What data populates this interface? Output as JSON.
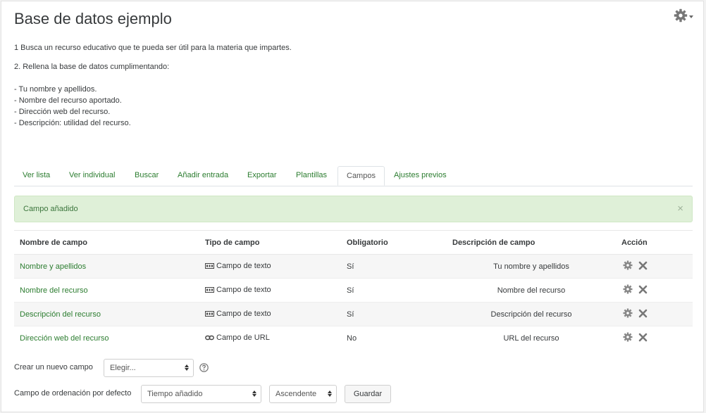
{
  "page": {
    "title": "Base de datos ejemplo"
  },
  "intro": {
    "lines": [
      "1  Busca un recurso educativo que te pueda ser útil para la materia que impartes.",
      "2. Rellena la base de datos cumplimentando:",
      "- Tu nombre y apellidos.",
      "- Nombre del recurso aportado.",
      "- Dirección web del recurso.",
      "- Descripción: utilidad del recurso."
    ]
  },
  "tabs": [
    {
      "label": "Ver lista"
    },
    {
      "label": "Ver individual"
    },
    {
      "label": "Buscar"
    },
    {
      "label": "Añadir entrada"
    },
    {
      "label": "Exportar"
    },
    {
      "label": "Plantillas"
    },
    {
      "label": "Campos",
      "active": true
    },
    {
      "label": "Ajustes previos"
    }
  ],
  "alert": {
    "message": "Campo añadido",
    "close": "×"
  },
  "table": {
    "headers": {
      "name": "Nombre de campo",
      "type": "Tipo de campo",
      "required": "Obligatorio",
      "description": "Descripción de campo",
      "action": "Acción"
    },
    "rows": [
      {
        "name": "Nombre y apellidos",
        "type": "Campo de texto",
        "type_icon": "text-field-icon",
        "required": "Sí",
        "description": "Tu nombre y apellidos"
      },
      {
        "name": "Nombre del recurso",
        "type": "Campo de texto",
        "type_icon": "text-field-icon",
        "required": "Sí",
        "description": "Nombre del recurso"
      },
      {
        "name": "Descripción del recurso",
        "type": "Campo de texto",
        "type_icon": "text-field-icon",
        "required": "Sí",
        "description": "Descripción del recurso"
      },
      {
        "name": "Dirección web del recurso",
        "type": "Campo de URL",
        "type_icon": "url-link-icon",
        "required": "No",
        "description": "URL del recurso"
      }
    ]
  },
  "new_field": {
    "label": "Crear un nuevo campo",
    "select_value": "Elegir..."
  },
  "sort": {
    "label": "Campo de ordenación por defecto",
    "field_value": "Tiempo añadido",
    "order_value": "Ascendente",
    "save_label": "Guardar"
  },
  "colors": {
    "link": "#2c7d30",
    "alert_bg": "#dff0d8",
    "alert_text": "#3c763d"
  }
}
